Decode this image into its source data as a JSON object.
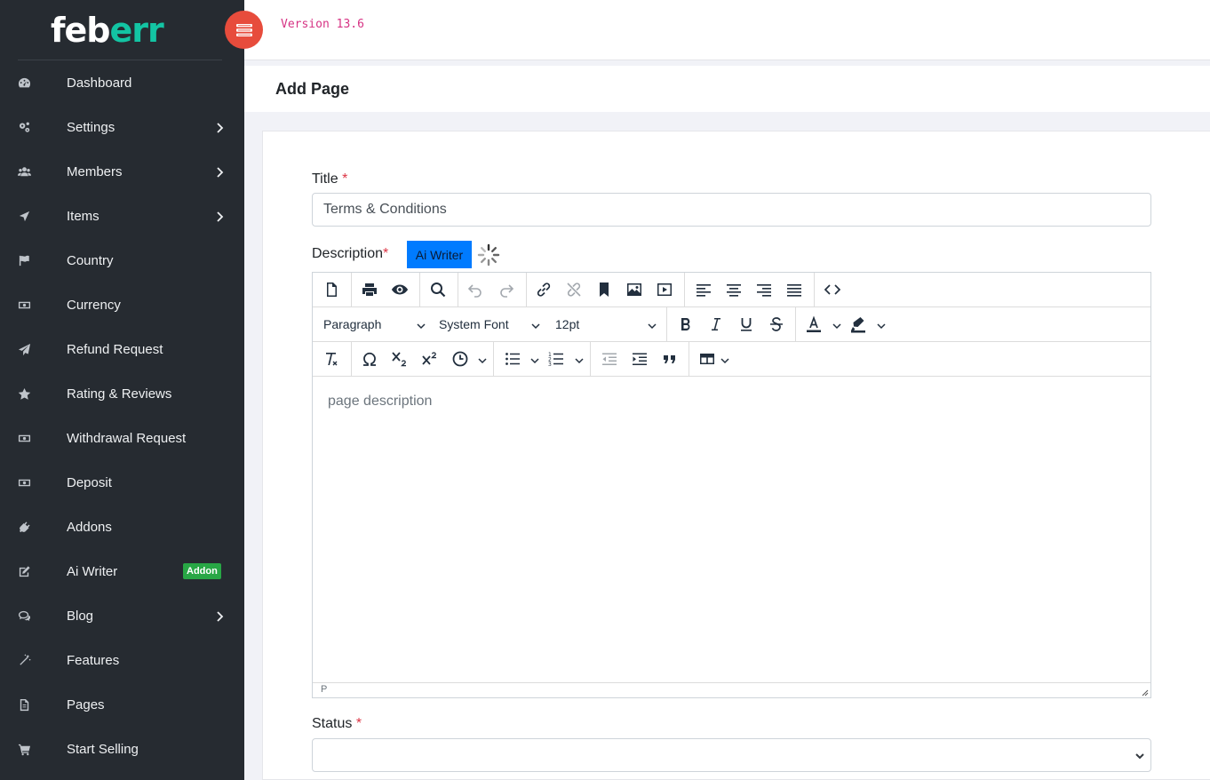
{
  "app": {
    "logo_main": "feb",
    "logo_accent": "err",
    "version": "Version 13.6"
  },
  "sidebar": {
    "items": [
      {
        "label": "Dashboard",
        "icon": "dashboard-icon",
        "has_submenu": false
      },
      {
        "label": "Settings",
        "icon": "gears-icon",
        "has_submenu": true
      },
      {
        "label": "Members",
        "icon": "users-icon",
        "has_submenu": true
      },
      {
        "label": "Items",
        "icon": "send-icon",
        "has_submenu": true
      },
      {
        "label": "Country",
        "icon": "flag-icon",
        "has_submenu": false
      },
      {
        "label": "Currency",
        "icon": "money-icon",
        "has_submenu": false
      },
      {
        "label": "Refund Request",
        "icon": "paper-plane-icon",
        "has_submenu": false
      },
      {
        "label": "Rating & Reviews",
        "icon": "star-icon",
        "has_submenu": false
      },
      {
        "label": "Withdrawal Request",
        "icon": "money-icon",
        "has_submenu": false
      },
      {
        "label": "Deposit",
        "icon": "money-icon",
        "has_submenu": false
      },
      {
        "label": "Addons",
        "icon": "plug-icon",
        "has_submenu": false
      },
      {
        "label": "Ai Writer",
        "icon": "edit-icon",
        "has_submenu": false,
        "badge": "Addon"
      },
      {
        "label": "Blog",
        "icon": "comments-icon",
        "has_submenu": true
      },
      {
        "label": "Features",
        "icon": "magic-icon",
        "has_submenu": false
      },
      {
        "label": "Pages",
        "icon": "file-icon",
        "has_submenu": false
      },
      {
        "label": "Start Selling",
        "icon": "cart-icon",
        "has_submenu": false
      }
    ]
  },
  "page": {
    "title": "Add Page"
  },
  "form": {
    "title_label": "Title",
    "title_required": "*",
    "title_value": "Terms & Conditions",
    "description_label": "Description",
    "description_required": "*",
    "ai_writer_button": "Ai Writer",
    "status_label": "Status",
    "status_required": "*",
    "status_value": ""
  },
  "editor": {
    "block_format": "Paragraph",
    "font_family": "System Font",
    "font_size": "12pt",
    "placeholder": "page description",
    "path": "P"
  },
  "colors": {
    "sidebar_bg": "#262b31",
    "logo_accent": "#13c4a3",
    "toggle_bg": "#e74c3c",
    "version_text": "#d63384",
    "primary": "#007bff",
    "addon_badge": "#28a745",
    "required": "#dc3545"
  }
}
